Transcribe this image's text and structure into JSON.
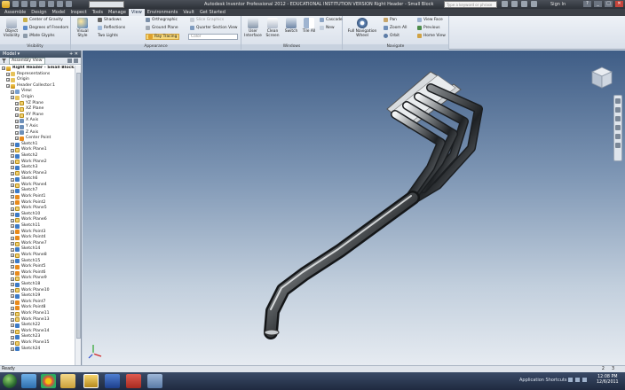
{
  "titlebar": {
    "title": "Autodesk Inventor Professional 2012 - EDUCATIONAL INSTITUTION VERSION    Right Header - Small Block",
    "search_placeholder": "Type a keyword or phrase",
    "sign_in": "Sign In"
  },
  "ribbon_tabs": [
    "Assemble",
    "Design",
    "Model",
    "Inspect",
    "Tools",
    "Manage",
    "View",
    "Environments",
    "Vault",
    "Get Started"
  ],
  "active_tab": "View",
  "ribbon": {
    "visibility": {
      "title": "Visibility",
      "object_visibility": "Object Visibility",
      "center_of_gravity": "Center of Gravity",
      "degrees_of_freedom": "Degrees of Freedom",
      "imate_glyphs": "iMate Glyphs"
    },
    "appearance": {
      "title": "Appearance",
      "visual_style": "Visual Style",
      "shadows": "Shadows",
      "reflections": "Reflections",
      "two_lights": "Two Lights",
      "orthographic": "Orthographic",
      "ground_plane": "Ground Plane",
      "ray_tracing": "Ray Tracing",
      "slice_graphics": "Slice Graphics",
      "quarter_section_view": "Quarter Section View",
      "color": "Color"
    },
    "windows": {
      "title": "Windows",
      "user_interface": "User Interface",
      "clean_screen": "Clean Screen",
      "switch": "Switch",
      "tile_all": "Tile All",
      "cascade": "Cascade",
      "new": "New"
    },
    "navigate": {
      "title": "Navigate",
      "full_navigation_wheel": "Full Navigation Wheel",
      "pan": "Pan",
      "zoom_all": "Zoom All",
      "orbit": "Orbit",
      "view_face": "View Face",
      "previous": "Previous",
      "home_view": "Home View"
    }
  },
  "browser": {
    "header": "Model",
    "view": "Assembly View",
    "tree": [
      {
        "label": "Right Header - Small Block.iam",
        "level": 0,
        "icon": "assembly-icon",
        "bold": true
      },
      {
        "label": "Representations",
        "level": 1,
        "icon": "folder-icon"
      },
      {
        "label": "Origin",
        "level": 1,
        "icon": "folder-icon"
      },
      {
        "label": "Header Collector:1",
        "level": 1,
        "icon": "assembly-icon"
      },
      {
        "label": "View:",
        "level": 2,
        "icon": "view-icon"
      },
      {
        "label": "Origin",
        "level": 2,
        "icon": "folder-icon"
      },
      {
        "label": "YZ Plane",
        "level": 3,
        "icon": "plane-icon"
      },
      {
        "label": "XZ Plane",
        "level": 3,
        "icon": "plane-icon"
      },
      {
        "label": "XY Plane",
        "level": 3,
        "icon": "plane-icon"
      },
      {
        "label": "X Axis",
        "level": 3,
        "icon": "axis-icon"
      },
      {
        "label": "Y Axis",
        "level": 3,
        "icon": "axis-icon"
      },
      {
        "label": "Z Axis",
        "level": 3,
        "icon": "axis-icon"
      },
      {
        "label": "Center Point",
        "level": 3,
        "icon": "point-icon"
      },
      {
        "label": "Sketch1",
        "level": 2,
        "icon": "sketch-icon"
      },
      {
        "label": "Work Plane1",
        "level": 2,
        "icon": "plane-icon"
      },
      {
        "label": "Sketch2",
        "level": 2,
        "icon": "sketch-icon"
      },
      {
        "label": "Work Plane2",
        "level": 2,
        "icon": "plane-icon"
      },
      {
        "label": "Sketch3",
        "level": 2,
        "icon": "sketch-icon"
      },
      {
        "label": "Work Plane3",
        "level": 2,
        "icon": "plane-icon"
      },
      {
        "label": "Sketch6",
        "level": 2,
        "icon": "sketch-icon"
      },
      {
        "label": "Work Plane4",
        "level": 2,
        "icon": "plane-icon"
      },
      {
        "label": "Sketch7",
        "level": 2,
        "icon": "sketch-icon"
      },
      {
        "label": "Work Point1",
        "level": 2,
        "icon": "point-icon"
      },
      {
        "label": "Work Point2",
        "level": 2,
        "icon": "point-icon"
      },
      {
        "label": "Work Plane5",
        "level": 2,
        "icon": "plane-icon"
      },
      {
        "label": "Sketch10",
        "level": 2,
        "icon": "sketch-icon"
      },
      {
        "label": "Work Plane6",
        "level": 2,
        "icon": "plane-icon"
      },
      {
        "label": "Sketch11",
        "level": 2,
        "icon": "sketch-icon"
      },
      {
        "label": "Work Point3",
        "level": 2,
        "icon": "point-icon"
      },
      {
        "label": "Work Point4",
        "level": 2,
        "icon": "point-icon"
      },
      {
        "label": "Work Plane7",
        "level": 2,
        "icon": "plane-icon"
      },
      {
        "label": "Sketch14",
        "level": 2,
        "icon": "sketch-icon"
      },
      {
        "label": "Work Plane8",
        "level": 2,
        "icon": "plane-icon"
      },
      {
        "label": "Sketch15",
        "level": 2,
        "icon": "sketch-icon"
      },
      {
        "label": "Work Point5",
        "level": 2,
        "icon": "point-icon"
      },
      {
        "label": "Work Point6",
        "level": 2,
        "icon": "point-icon"
      },
      {
        "label": "Work Plane9",
        "level": 2,
        "icon": "plane-icon"
      },
      {
        "label": "Sketch18",
        "level": 2,
        "icon": "sketch-icon"
      },
      {
        "label": "Work Plane10",
        "level": 2,
        "icon": "plane-icon"
      },
      {
        "label": "Sketch19",
        "level": 2,
        "icon": "sketch-icon"
      },
      {
        "label": "Work Point7",
        "level": 2,
        "icon": "point-icon"
      },
      {
        "label": "Work Point8",
        "level": 2,
        "icon": "point-icon"
      },
      {
        "label": "Work Plane11",
        "level": 2,
        "icon": "plane-icon"
      },
      {
        "label": "Work Plane13",
        "level": 2,
        "icon": "plane-icon"
      },
      {
        "label": "Sketch22",
        "level": 2,
        "icon": "sketch-icon"
      },
      {
        "label": "Work Plane14",
        "level": 2,
        "icon": "plane-icon"
      },
      {
        "label": "Sketch23",
        "level": 2,
        "icon": "sketch-icon"
      },
      {
        "label": "Work Plane15",
        "level": 2,
        "icon": "plane-icon"
      },
      {
        "label": "Sketch24",
        "level": 2,
        "icon": "sketch-icon"
      }
    ]
  },
  "viewport": {
    "tabs_right": [
      "2",
      "3"
    ]
  },
  "statusbar": {
    "text": "Ready",
    "counts": [
      "2",
      "3"
    ]
  },
  "taskbar": {
    "tray_label": "Application Shortcuts",
    "time": "12:08 PM",
    "date": "12/6/2011"
  },
  "colors": {
    "viewport_top": "#3f5d86",
    "viewport_bottom": "#e6ebf1",
    "accent": "#f5d77a"
  }
}
